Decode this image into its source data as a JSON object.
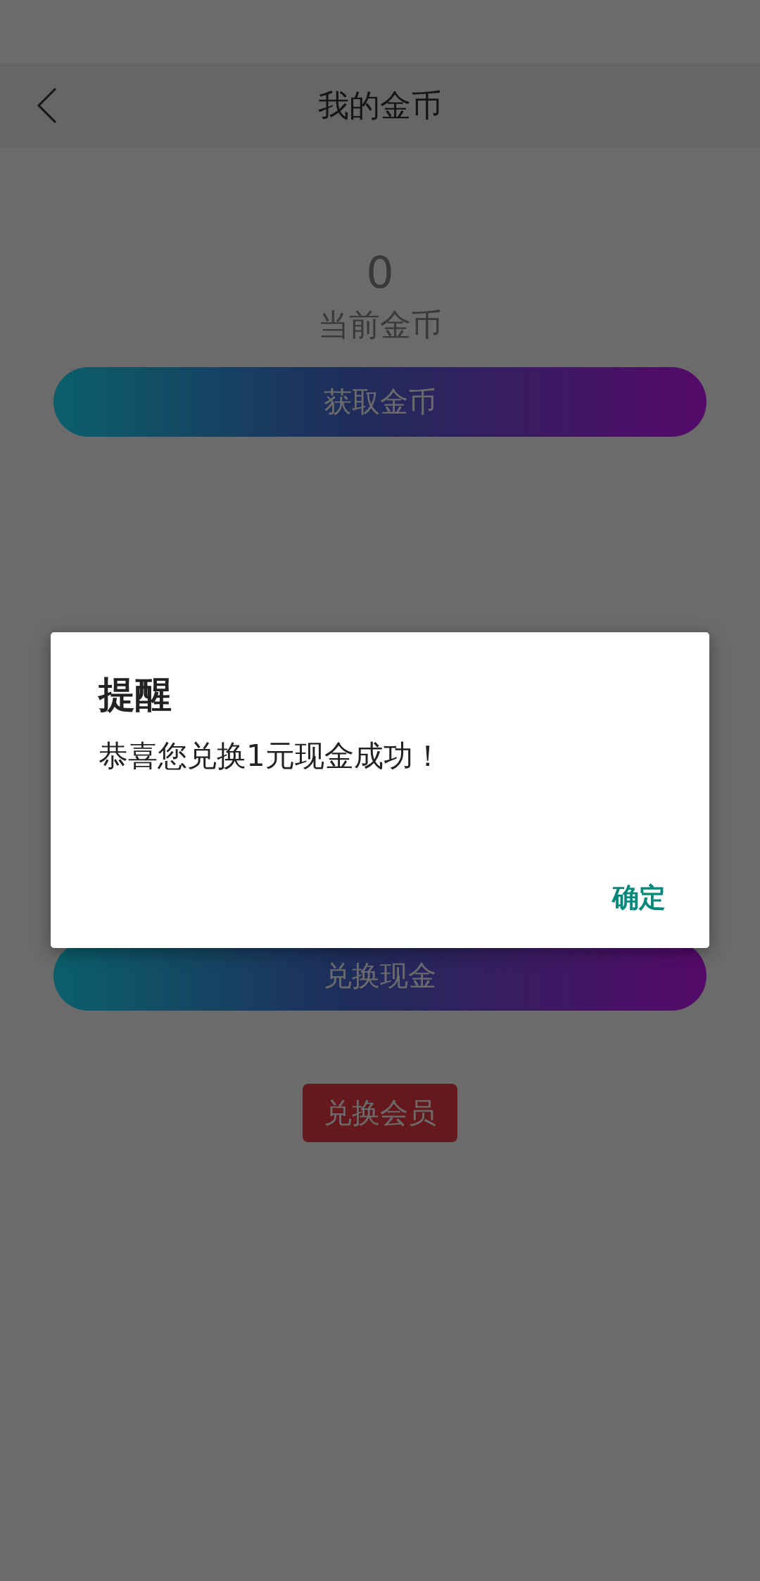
{
  "header": {
    "title": "我的金币"
  },
  "coins": {
    "value": "0",
    "label": "当前金币"
  },
  "buttons": [
    {
      "label": "获取金币",
      "kind": "gradient"
    },
    {
      "label": "兑换现金",
      "kind": "gradient"
    },
    {
      "label": "兑换会员",
      "kind": "solid"
    }
  ],
  "dialog": {
    "title": "提醒",
    "message": "恭喜您兑换1元现金成功！",
    "confirm": "确定"
  }
}
